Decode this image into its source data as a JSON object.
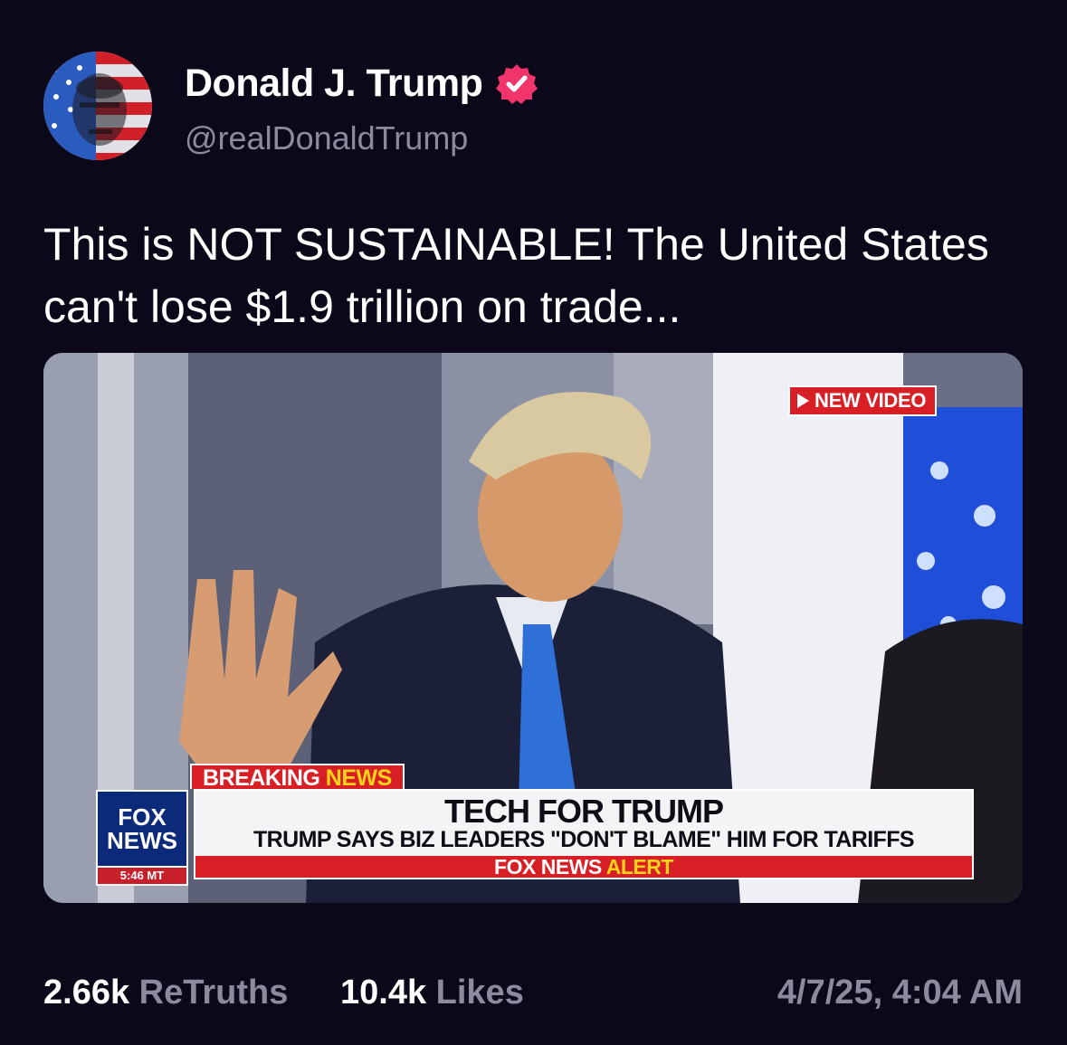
{
  "post": {
    "author_name": "Donald J. Trump",
    "handle": "@realDonaldTrump",
    "verified_icon": "verified-badge-icon",
    "avatar_icon": "flag-portrait-avatar",
    "text": "This is NOT SUSTAINABLE! The United States can't lose $1.9 trillion on trade...",
    "verified_color": "#f2346d"
  },
  "media": {
    "badge_label": "NEW VIDEO",
    "network_logo_line1": "FOX",
    "network_logo_line2": "NEWS",
    "network_time": "5:46 MT",
    "breaking_word1": "BREAKING",
    "breaking_word2": "NEWS",
    "headline": "TECH FOR TRUMP",
    "subheadline": "TRUMP SAYS BIZ LEADERS \"DON'T BLAME\" HIM FOR TARIFFS",
    "alert_part1": "FOX NEWS",
    "alert_part2": "ALERT"
  },
  "stats": {
    "retruths_count": "2.66k",
    "retruths_label": "ReTruths",
    "likes_count": "10.4k",
    "likes_label": "Likes",
    "timestamp": "4/7/25, 4:04 AM"
  },
  "colors": {
    "background": "#0b0819",
    "muted_text": "#8e8a9e",
    "fox_red": "#d81f26",
    "fox_blue": "#0c2a7a",
    "fox_yellow": "#ffd21a"
  }
}
